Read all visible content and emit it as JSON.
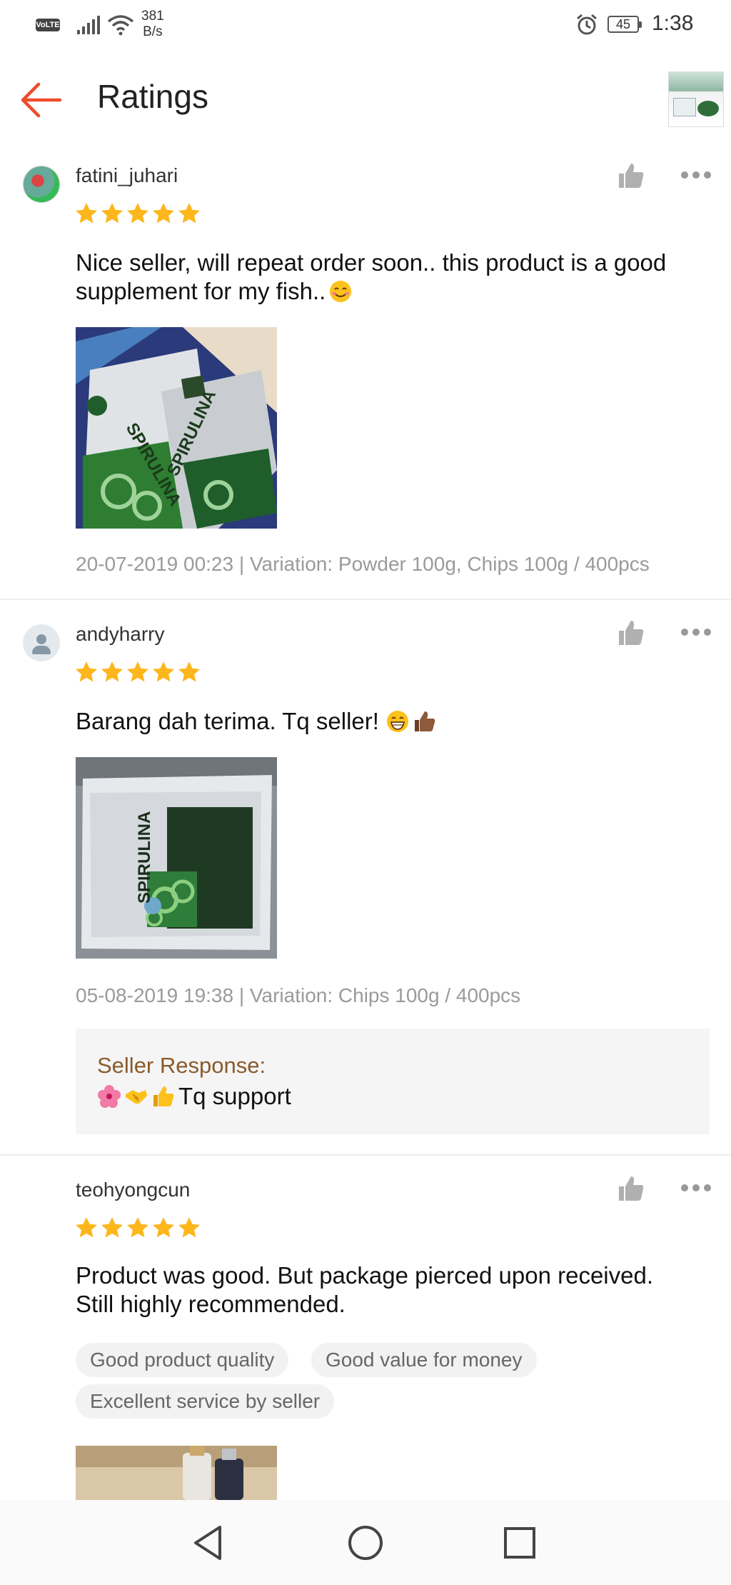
{
  "status_bar": {
    "volte": "VoLTE",
    "net_speed_value": "381",
    "net_speed_unit": "B/s",
    "battery": "45",
    "time": "1:38",
    "icons": [
      "signal-icon",
      "wifi-icon",
      "alarm-icon",
      "battery-icon"
    ]
  },
  "header": {
    "title": "Ratings",
    "back_icon": "arrow-left-icon",
    "thumbnail": "product-thumbnail",
    "accent_color": "#ee4d2d"
  },
  "reviews": [
    {
      "username": "fatini_juhari",
      "rating": 5,
      "text_line1": "Nice seller, will repeat order soon.. this product is a good",
      "text_line2": "supplement for my fish..",
      "text_emoji": "smiling-face",
      "meta": "20-07-2019 00:23 | Variation: Powder 100g, Chips 100g / 400pcs",
      "photo_labels": [
        "SPIRULINA",
        "SPIRULINA"
      ]
    },
    {
      "username": "andyharry",
      "rating": 5,
      "text": "Barang dah terima. Tq seller! ",
      "text_emojis": [
        "grinning-face",
        "thumbs-up"
      ],
      "meta": "05-08-2019 19:38 | Variation: Chips 100g / 400pcs",
      "photo_labels": [
        "SPIRULINA"
      ],
      "seller_response": {
        "label": "Seller Response:",
        "emojis": [
          "hibiscus",
          "handshake",
          "thumbs-up"
        ],
        "text": "Tq support"
      }
    },
    {
      "username": "teohyongcun",
      "rating": 5,
      "text_line1": "Product was good. But package pierced upon received.",
      "text_line2": "Still highly recommended.",
      "tags": [
        "Good product quality",
        "Good value for money",
        "Excellent service by seller"
      ]
    }
  ],
  "colors": {
    "star": "#fdb61b",
    "seller_label": "#8a5a2b",
    "meta": "#9a9a9a"
  },
  "nav_bar": {
    "icons": [
      "back-triangle-icon",
      "home-circle-icon",
      "recents-square-icon"
    ]
  }
}
